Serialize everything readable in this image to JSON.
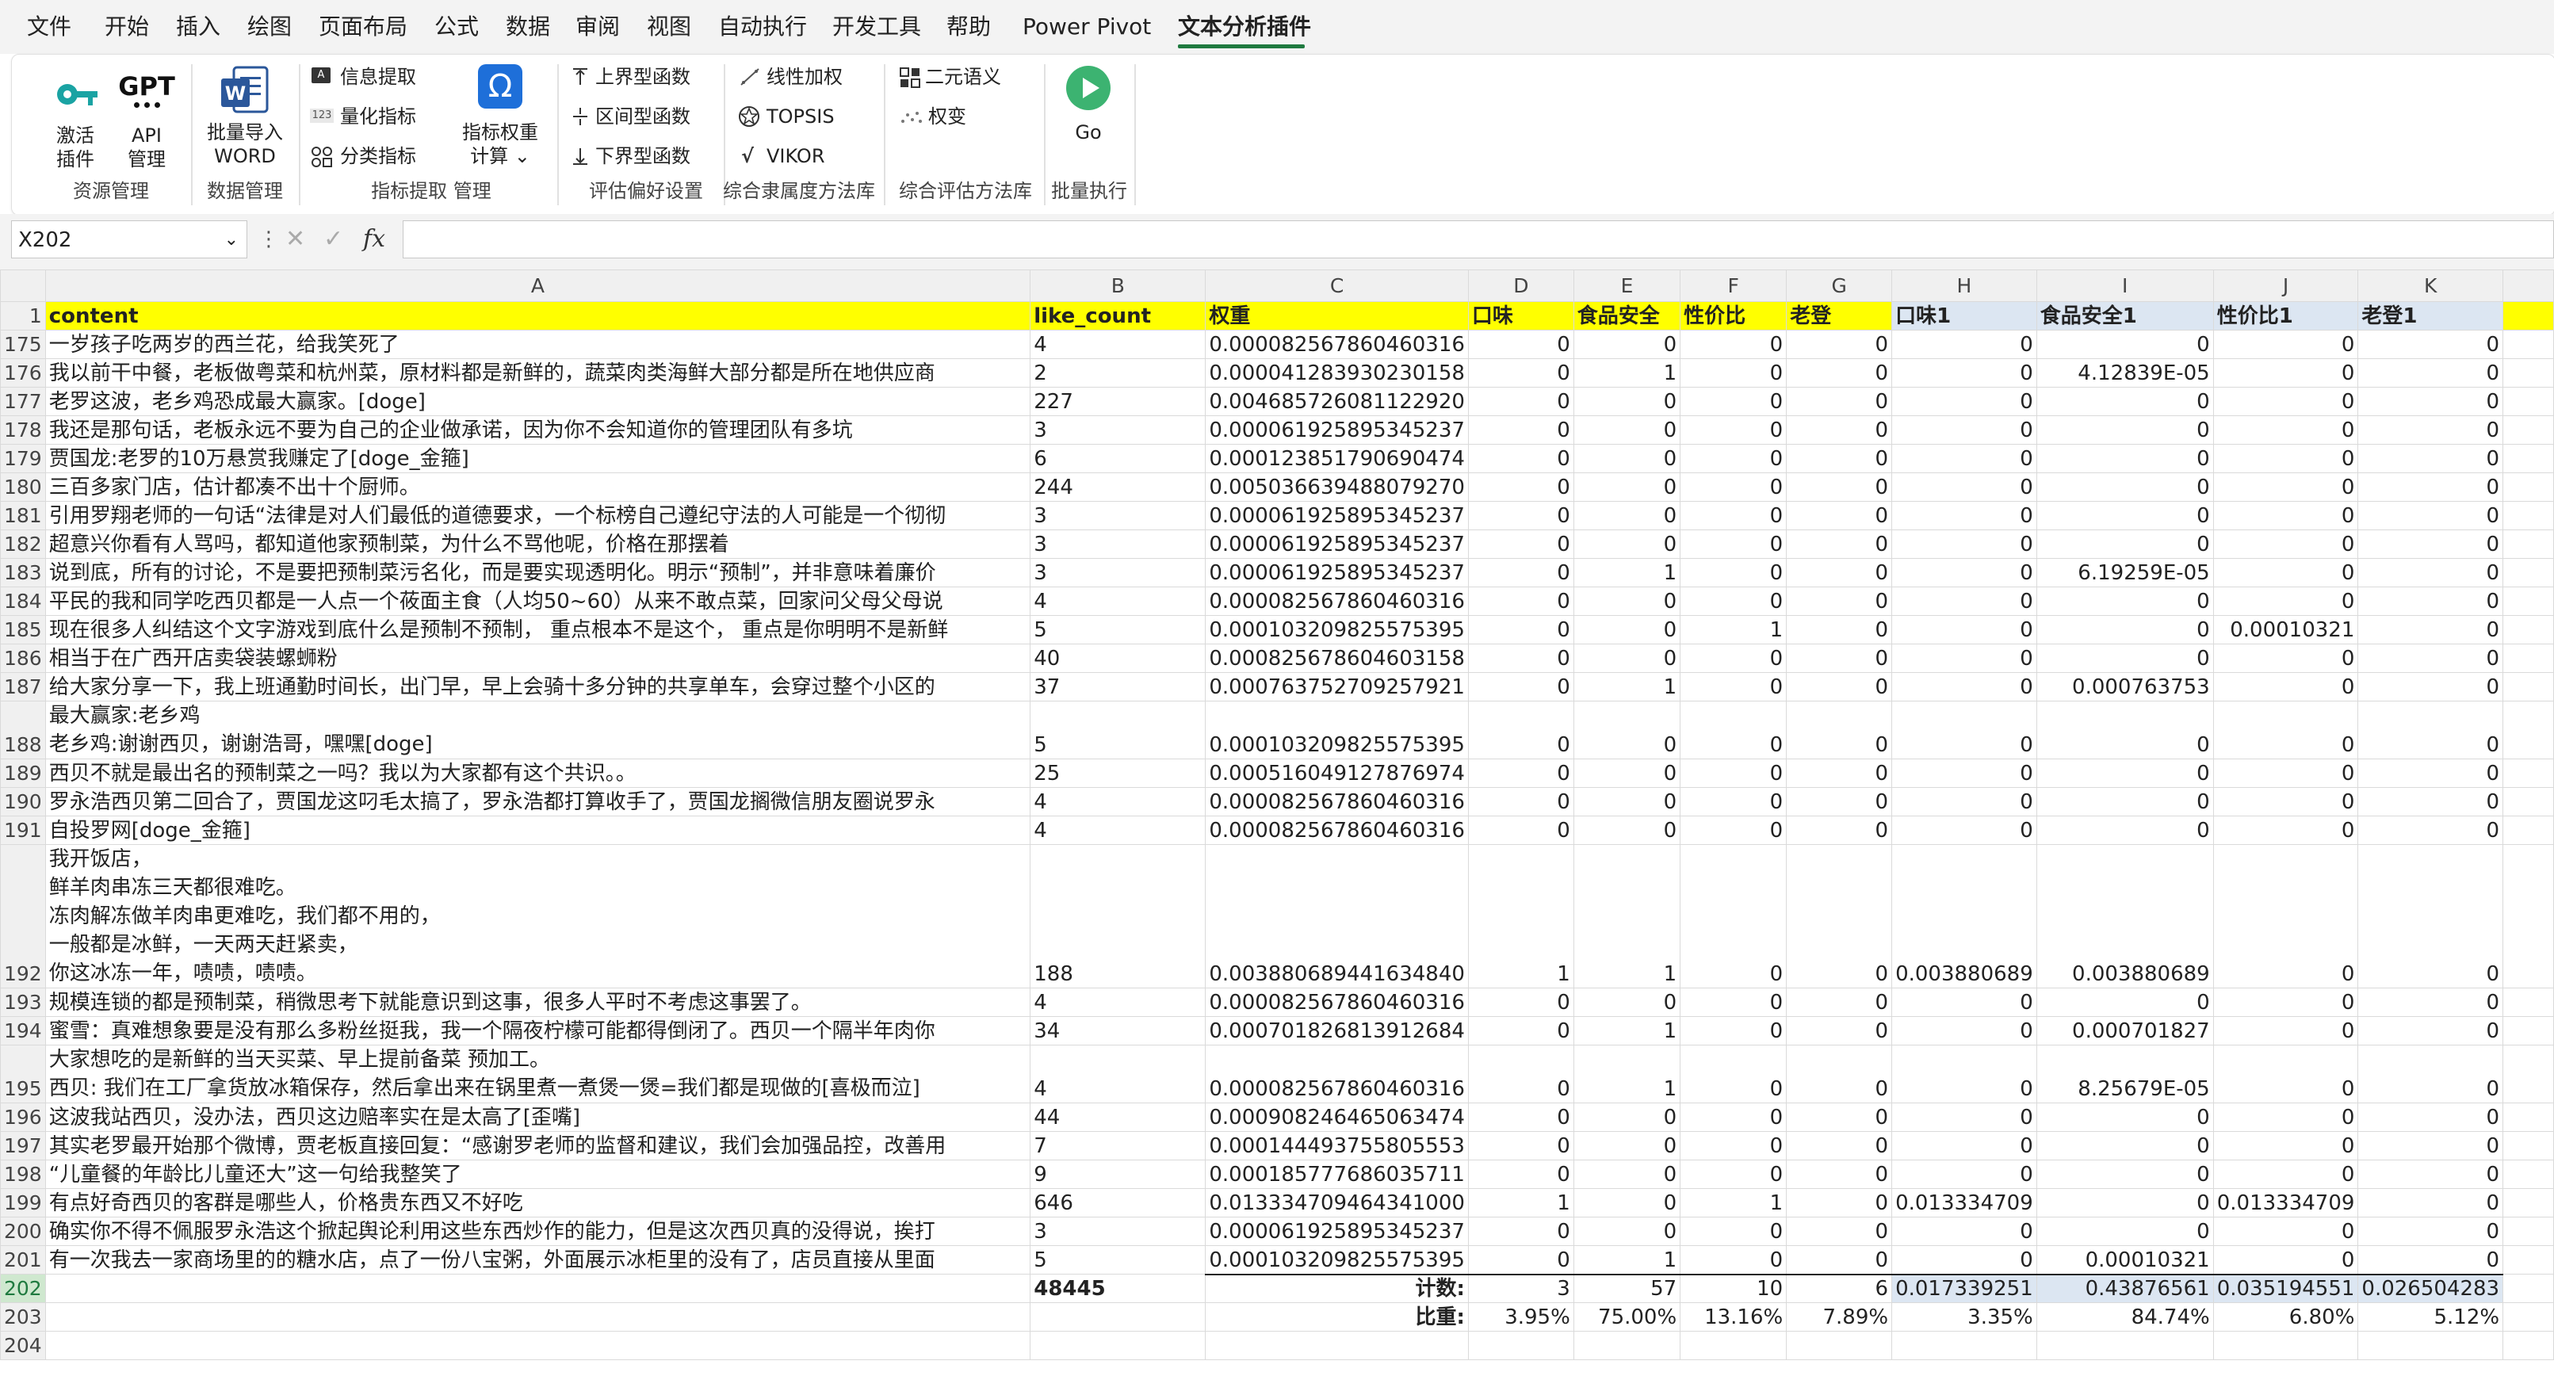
{
  "menu_tabs": [
    "文件",
    "开始",
    "插入",
    "绘图",
    "页面布局",
    "公式",
    "数据",
    "审阅",
    "视图",
    "自动执行",
    "开发工具",
    "帮助",
    "Power Pivot",
    "文本分析插件"
  ],
  "ribbon": {
    "activate_label_1": "激活",
    "activate_label_2": "插件",
    "gpt_icon_text": "GPT",
    "api_label_1": "API",
    "api_label_2": "管理",
    "group_resource": "资源管理",
    "word_label_1": "批量导入",
    "word_label_2": "WORD",
    "group_data": "数据管理",
    "info_extract": "信息提取",
    "quantify": "量化指标",
    "classify": "分类指标",
    "weight_label_1": "指标权重",
    "weight_label_2": "计算",
    "group_indicator": "指标提取 管理",
    "upper_func": "上界型函数",
    "interval_func": "区间型函数",
    "lower_func": "下界型函数",
    "group_preference": "评估偏好设置",
    "linear_weight": "线性加权",
    "topsis": "TOPSIS",
    "vikor": "VIKOR",
    "group_membership": "综合隶属度方法库",
    "binary_semantic": "二元语义",
    "weight_change": "权变",
    "group_eval": "综合评估方法库",
    "go_label": "Go",
    "group_batch": "批量执行"
  },
  "formula_bar": {
    "name_box": "X202",
    "fx": "fx",
    "formula": ""
  },
  "columns": [
    "A",
    "B",
    "C",
    "D",
    "E",
    "F",
    "G",
    "H",
    "I",
    "J",
    "K"
  ],
  "header_row": {
    "num": "1",
    "cells": [
      "content",
      "like_count",
      "权重",
      "口味",
      "食品安全",
      "性价比",
      "老登",
      "口味1",
      "食品安全1",
      "性价比1",
      "老登1"
    ]
  },
  "rows": [
    {
      "num": "175",
      "content": "一岁孩子吃两岁的西兰花，给我笑死了",
      "like": "4",
      "w": "0.000082567860460316",
      "d": "0",
      "e": "0",
      "f": "0",
      "g": "0",
      "h": "0",
      "i": "0",
      "j": "0",
      "k": "0"
    },
    {
      "num": "176",
      "content": "我以前干中餐，老板做粤菜和杭州菜，原材料都是新鲜的，蔬菜肉类海鲜大部分都是所在地供应商",
      "like": "2",
      "w": "0.000041283930230158",
      "d": "0",
      "e": "1",
      "f": "0",
      "g": "0",
      "h": "0",
      "i": "4.12839E-05",
      "j": "0",
      "k": "0"
    },
    {
      "num": "177",
      "content": "老罗这波，老乡鸡恐成最大赢家。[doge]",
      "like": "227",
      "w": "0.004685726081122920",
      "d": "0",
      "e": "0",
      "f": "0",
      "g": "0",
      "h": "0",
      "i": "0",
      "j": "0",
      "k": "0"
    },
    {
      "num": "178",
      "content": "我还是那句话，老板永远不要为自己的企业做承诺，因为你不会知道你的管理团队有多坑",
      "like": "3",
      "w": "0.000061925895345237",
      "d": "0",
      "e": "0",
      "f": "0",
      "g": "0",
      "h": "0",
      "i": "0",
      "j": "0",
      "k": "0"
    },
    {
      "num": "179",
      "content": "贾国龙:老罗的10万悬赏我赚定了[doge_金箍]",
      "like": "6",
      "w": "0.000123851790690474",
      "d": "0",
      "e": "0",
      "f": "0",
      "g": "0",
      "h": "0",
      "i": "0",
      "j": "0",
      "k": "0"
    },
    {
      "num": "180",
      "content": "三百多家门店，估计都凑不出十个厨师。",
      "like": "244",
      "w": "0.005036639488079270",
      "d": "0",
      "e": "0",
      "f": "0",
      "g": "0",
      "h": "0",
      "i": "0",
      "j": "0",
      "k": "0"
    },
    {
      "num": "181",
      "content": "引用罗翔老师的一句话“法律是对人们最低的道德要求，一个标榜自己遵纪守法的人可能是一个彻彻",
      "like": "3",
      "w": "0.000061925895345237",
      "d": "0",
      "e": "0",
      "f": "0",
      "g": "0",
      "h": "0",
      "i": "0",
      "j": "0",
      "k": "0"
    },
    {
      "num": "182",
      "content": "超意兴你看有人骂吗，都知道他家预制菜，为什么不骂他呢，价格在那摆着",
      "like": "3",
      "w": "0.000061925895345237",
      "d": "0",
      "e": "0",
      "f": "0",
      "g": "0",
      "h": "0",
      "i": "0",
      "j": "0",
      "k": "0"
    },
    {
      "num": "183",
      "content": "说到底，所有的讨论，不是要把预制菜污名化，而是要实现透明化。明示“预制”，并非意味着廉价",
      "like": "3",
      "w": "0.000061925895345237",
      "d": "0",
      "e": "1",
      "f": "0",
      "g": "0",
      "h": "0",
      "i": "6.19259E-05",
      "j": "0",
      "k": "0"
    },
    {
      "num": "184",
      "content": "平民的我和同学吃西贝都是一人点一个莜面主食（人均50~60）从来不敢点菜，回家问父母父母说",
      "like": "4",
      "w": "0.000082567860460316",
      "d": "0",
      "e": "0",
      "f": "0",
      "g": "0",
      "h": "0",
      "i": "0",
      "j": "0",
      "k": "0"
    },
    {
      "num": "185",
      "content": "现在很多人纠结这个文字游戏到底什么是预制不预制， 重点根本不是这个， 重点是你明明不是新鲜",
      "like": "5",
      "w": "0.000103209825575395",
      "d": "0",
      "e": "0",
      "f": "1",
      "g": "0",
      "h": "0",
      "i": "0",
      "j": "0.00010321",
      "k": "0"
    },
    {
      "num": "186",
      "content": "相当于在广西开店卖袋装螺蛳粉",
      "like": "40",
      "w": "0.000825678604603158",
      "d": "0",
      "e": "0",
      "f": "0",
      "g": "0",
      "h": "0",
      "i": "0",
      "j": "0",
      "k": "0"
    },
    {
      "num": "187",
      "content": "给大家分享一下，我上班通勤时间长，出门早，早上会骑十多分钟的共享单车，会穿过整个小区的",
      "like": "37",
      "w": "0.000763752709257921",
      "d": "0",
      "e": "1",
      "f": "0",
      "g": "0",
      "h": "0",
      "i": "0.000763753",
      "j": "0",
      "k": "0"
    },
    {
      "num": "188",
      "content": "最大赢家:老乡鸡\n老乡鸡:谢谢西贝，谢谢浩哥，嘿嘿[doge]",
      "like": "5",
      "w": "0.000103209825575395",
      "d": "0",
      "e": "0",
      "f": "0",
      "g": "0",
      "h": "0",
      "i": "0",
      "j": "0",
      "k": "0"
    },
    {
      "num": "189",
      "content": "西贝不就是最出名的预制菜之一吗？我以为大家都有这个共识。。",
      "like": "25",
      "w": "0.000516049127876974",
      "d": "0",
      "e": "0",
      "f": "0",
      "g": "0",
      "h": "0",
      "i": "0",
      "j": "0",
      "k": "0"
    },
    {
      "num": "190",
      "content": "罗永浩西贝第二回合了，贾国龙这叼毛太搞了，罗永浩都打算收手了，贾国龙搁微信朋友圈说罗永",
      "like": "4",
      "w": "0.000082567860460316",
      "d": "0",
      "e": "0",
      "f": "0",
      "g": "0",
      "h": "0",
      "i": "0",
      "j": "0",
      "k": "0"
    },
    {
      "num": "191",
      "content": "自投罗网[doge_金箍]",
      "like": "4",
      "w": "0.000082567860460316",
      "d": "0",
      "e": "0",
      "f": "0",
      "g": "0",
      "h": "0",
      "i": "0",
      "j": "0",
      "k": "0"
    },
    {
      "num": "192",
      "content": "我开饭店，\n鲜羊肉串冻三天都很难吃。\n冻肉解冻做羊肉串更难吃，我们都不用的，\n一般都是冰鲜，一天两天赶紧卖，\n你这冰冻一年，啧啧，啧啧。",
      "like": "188",
      "w": "0.003880689441634840",
      "d": "1",
      "e": "1",
      "f": "0",
      "g": "0",
      "h": "0.003880689",
      "i": "0.003880689",
      "j": "0",
      "k": "0"
    },
    {
      "num": "193",
      "content": "规模连锁的都是预制菜，稍微思考下就能意识到这事，很多人平时不考虑这事罢了。",
      "like": "4",
      "w": "0.000082567860460316",
      "d": "0",
      "e": "0",
      "f": "0",
      "g": "0",
      "h": "0",
      "i": "0",
      "j": "0",
      "k": "0"
    },
    {
      "num": "194",
      "content": "蜜雪：真难想象要是没有那么多粉丝挺我，我一个隔夜柠檬可能都得倒闭了。西贝一个隔半年肉你",
      "like": "34",
      "w": "0.000701826813912684",
      "d": "0",
      "e": "1",
      "f": "0",
      "g": "0",
      "h": "0",
      "i": "0.000701827",
      "j": "0",
      "k": "0"
    },
    {
      "num": "195",
      "content": "大家想吃的是新鲜的当天买菜、早上提前备菜 预加工。\n西贝: 我们在工厂拿货放冰箱保存，然后拿出来在锅里煮一煮煲一煲=我们都是现做的[喜极而泣]",
      "like": "4",
      "w": "0.000082567860460316",
      "d": "0",
      "e": "1",
      "f": "0",
      "g": "0",
      "h": "0",
      "i": "8.25679E-05",
      "j": "0",
      "k": "0"
    },
    {
      "num": "196",
      "content": "这波我站西贝，没办法，西贝这边赔率实在是太高了[歪嘴]",
      "like": "44",
      "w": "0.000908246465063474",
      "d": "0",
      "e": "0",
      "f": "0",
      "g": "0",
      "h": "0",
      "i": "0",
      "j": "0",
      "k": "0"
    },
    {
      "num": "197",
      "content": "其实老罗最开始那个微博，贾老板直接回复：“感谢罗老师的监督和建议，我们会加强品控，改善用",
      "like": "7",
      "w": "0.000144493755805553",
      "d": "0",
      "e": "0",
      "f": "0",
      "g": "0",
      "h": "0",
      "i": "0",
      "j": "0",
      "k": "0"
    },
    {
      "num": "198",
      "content": "“儿童餐的年龄比儿童还大”这一句给我整笑了",
      "like": "9",
      "w": "0.000185777686035711",
      "d": "0",
      "e": "0",
      "f": "0",
      "g": "0",
      "h": "0",
      "i": "0",
      "j": "0",
      "k": "0"
    },
    {
      "num": "199",
      "content": "有点好奇西贝的客群是哪些人，价格贵东西又不好吃",
      "like": "646",
      "w": "0.013334709464341000",
      "d": "1",
      "e": "0",
      "f": "1",
      "g": "0",
      "h": "0.013334709",
      "i": "0",
      "j": "0.013334709",
      "k": "0"
    },
    {
      "num": "200",
      "content": "确实你不得不佩服罗永浩这个掀起舆论利用这些东西炒作的能力，但是这次西贝真的没得说，挨打",
      "like": "3",
      "w": "0.000061925895345237",
      "d": "0",
      "e": "0",
      "f": "0",
      "g": "0",
      "h": "0",
      "i": "0",
      "j": "0",
      "k": "0"
    },
    {
      "num": "201",
      "content": "有一次我去一家商场里的的糖水店，点了一份八宝粥，外面展示冰柜里的没有了，店员直接从里面",
      "like": "5",
      "w": "0.000103209825575395",
      "d": "0",
      "e": "1",
      "f": "0",
      "g": "0",
      "h": "0",
      "i": "0.00010321",
      "j": "0",
      "k": "0"
    }
  ],
  "totals": {
    "row202": {
      "num": "202",
      "like_total": "48445",
      "label": "计数:",
      "d": "3",
      "e": "57",
      "f": "10",
      "g": "6",
      "h": "0.017339251",
      "i": "0.43876561",
      "j": "0.035194551",
      "k": "0.026504283"
    },
    "row203": {
      "num": "203",
      "label": "比重:",
      "d": "3.95%",
      "e": "75.00%",
      "f": "13.16%",
      "g": "7.89%",
      "h": "3.35%",
      "i": "84.74%",
      "j": "6.80%",
      "k": "5.12%"
    },
    "row204": {
      "num": "204"
    }
  }
}
